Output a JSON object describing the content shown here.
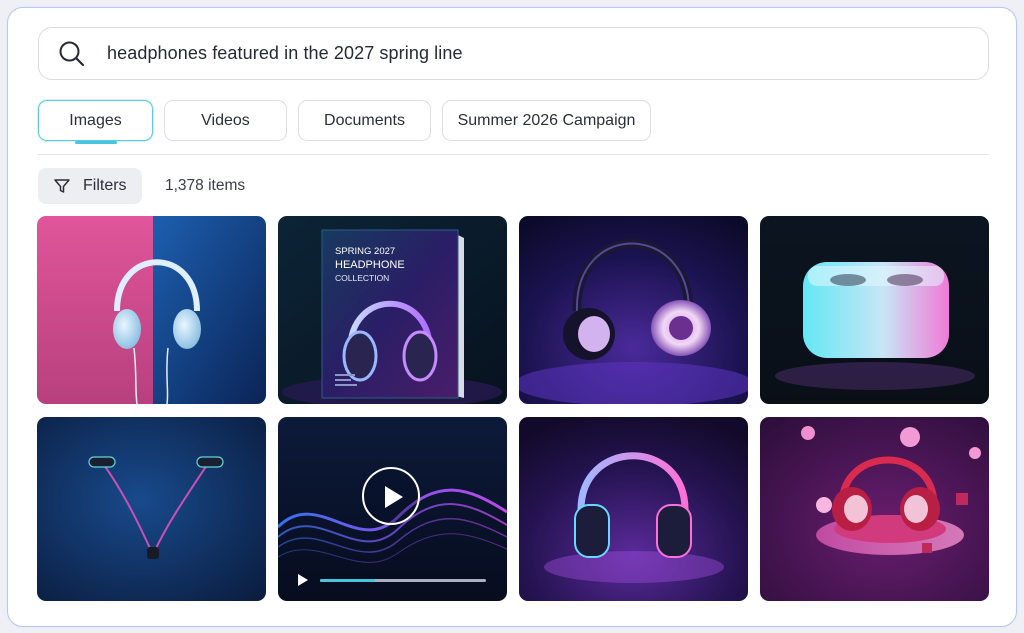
{
  "search": {
    "query": "headphones featured in the 2027 spring line",
    "icon": "search-icon"
  },
  "tabs": [
    {
      "label": "Images",
      "active": true
    },
    {
      "label": "Videos",
      "active": false
    },
    {
      "label": "Documents",
      "active": false
    },
    {
      "label": "Summer 2026 Campaign",
      "active": false
    }
  ],
  "toolbar": {
    "filters_label": "Filters",
    "filters_icon": "filter-icon",
    "item_count": "1,378 items"
  },
  "results": {
    "brochure": {
      "line1": "SPRING 2027",
      "line2": "HEADPHONE",
      "line3": "COLLECTION"
    },
    "video": {
      "progress": 0.33
    }
  },
  "colors": {
    "accent": "#47c5dc",
    "border": "#b9c6f2"
  }
}
